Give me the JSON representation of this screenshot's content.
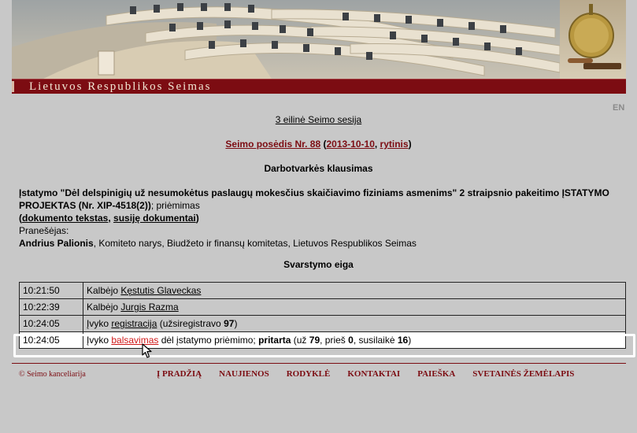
{
  "header": {
    "banner_alt": "",
    "title": "Lietuvos Respublikos Seimas"
  },
  "lang_link": "EN",
  "session": "3 eilinė Seimo sesija",
  "sitting": {
    "label": "Seimo posėdis Nr. 88",
    "open_paren": " (",
    "date": "2013-10-10",
    "comma": ", ",
    "time_of_day": "rytinis",
    "close_paren": ")"
  },
  "agenda_heading": "Darbotvarkės klausimas",
  "agenda_item": {
    "title": "Įstatymo \"Dėl delspinigių už nesumokėtus paslaugų mokesčius skaičiavimo fiziniams asmenims\" 2 straipsnio pakeitimo ĮSTATYMO PROJEKTAS (Nr. XIP-4518(2))",
    "title_suffix": "; priėmimas",
    "doc_text_link": "dokumento tekstas",
    "related_docs_link": "susiję dokumentai",
    "rapporteur_label": "Pranešėjas:",
    "rapporteur_name": "Andrius Palionis",
    "rapporteur_roles": ", Komiteto narys, Biudžeto ir finansų komitetas, Lietuvos Respublikos Seimas"
  },
  "process_heading": "Svarstymo eiga",
  "events": [
    {
      "time": "10:21:50",
      "prefix": "Kalbėjo ",
      "link": "Kęstutis Glaveckas"
    },
    {
      "time": "10:22:39",
      "prefix": "Kalbėjo ",
      "link": "Jurgis Razma"
    },
    {
      "time": "10:24:05",
      "prefix": "Įvyko ",
      "link": "registracija",
      "suffix_pre": " (užsiregistravo ",
      "count": "97",
      "suffix_post": ")"
    },
    {
      "time": "10:24:05",
      "prefix": "Įvyko ",
      "link": "balsavimas",
      "suffix_pre": " dėl įstatymo priėmimo; ",
      "result": "pritarta",
      "for_label": "  (už ",
      "for": "79",
      "against_label": ", prieš ",
      "against": "0",
      "abstain_label": ", susilaikė ",
      "abstain": "16",
      "close": ")"
    }
  ],
  "footer": {
    "copyright": "© Seimo kanceliarija",
    "nav": [
      "Į PRADŽIĄ",
      "NAUJIENOS",
      "RODYKLĖ",
      "KONTAKTAI",
      "PAIEŠKA",
      "SVETAINĖS ŽEMĖLAPIS"
    ]
  },
  "colors": {
    "accent": "#7c0c12",
    "background": "#c8c8c8",
    "vote_link": "#d01818"
  }
}
